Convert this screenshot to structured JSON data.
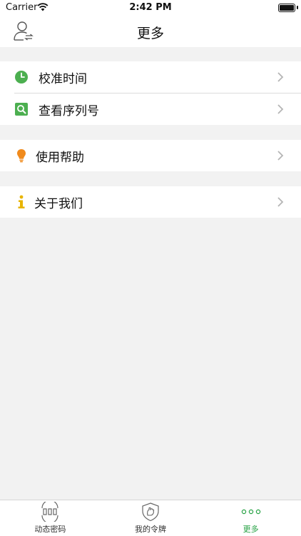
{
  "status_bar": {
    "carrier": "Carrier",
    "time": "2:42 PM"
  },
  "nav": {
    "title": "更多"
  },
  "sections": [
    {
      "items": [
        {
          "label": "校准时间",
          "icon": "clock-icon",
          "color": "#4caf50"
        },
        {
          "label": "查看序列号",
          "icon": "search-icon",
          "color": "#4caf50"
        }
      ]
    },
    {
      "items": [
        {
          "label": "使用帮助",
          "icon": "lightbulb-icon",
          "color": "#f08a1c"
        }
      ]
    },
    {
      "items": [
        {
          "label": "关于我们",
          "icon": "info-icon",
          "color": "#e8b400"
        }
      ]
    }
  ],
  "tabbar": {
    "tabs": [
      {
        "label": "动态密码",
        "icon": "dynamic-password-icon",
        "active": false
      },
      {
        "label": "我的令牌",
        "icon": "shield-token-icon",
        "active": false
      },
      {
        "label": "更多",
        "icon": "more-dots-icon",
        "active": true
      }
    ],
    "active_color": "#26a244"
  }
}
